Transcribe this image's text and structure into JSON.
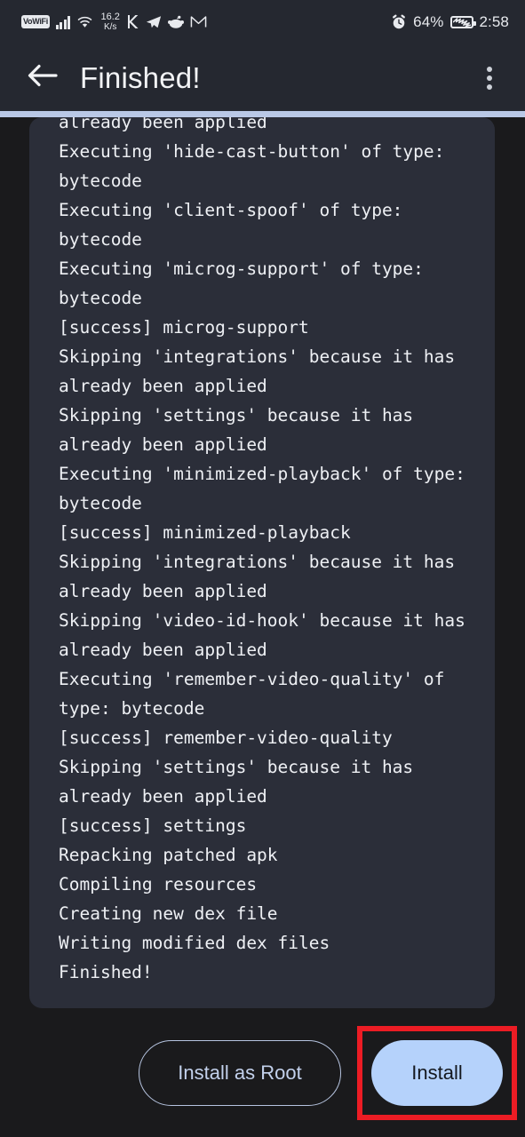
{
  "status_bar": {
    "vowifi_label": "VoWiFi",
    "network_speed_value": "16.2",
    "network_speed_unit": "K/s",
    "app_icons": [
      "kotlin-icon",
      "telegram-icon",
      "reddit-icon",
      "gmail-icon"
    ],
    "alarm_icon": "alarm-clock-icon",
    "battery_percent": "64%",
    "battery_icon": "battery-saver-icon",
    "time": "2:58"
  },
  "app_bar": {
    "back_icon": "back-arrow-icon",
    "title": "Finished!",
    "overflow_icon": "overflow-menu-icon"
  },
  "progress": {
    "percent": 100
  },
  "log": {
    "lines": [
      "already been applied",
      "Executing 'hide-cast-button' of type: bytecode",
      "Executing 'client-spoof' of type: bytecode",
      "Executing 'microg-support' of type: bytecode",
      "[success] microg-support",
      "Skipping 'integrations' because it has already been applied",
      "Skipping 'settings' because it has already been applied",
      "Executing 'minimized-playback' of type: bytecode",
      "[success] minimized-playback",
      "Skipping 'integrations' because it has already been applied",
      "Skipping 'video-id-hook' because it has already been applied",
      "Executing 'remember-video-quality' of type: bytecode",
      "[success] remember-video-quality",
      "Skipping 'settings' because it has already been applied",
      "[success] settings",
      "Repacking patched apk",
      "Compiling resources",
      "Creating new dex file",
      "Writing modified dex files",
      "Finished!"
    ],
    "text": "already been applied\nExecuting 'hide-cast-button' of type: bytecode\nExecuting 'client-spoof' of type: bytecode\nExecuting 'microg-support' of type: bytecode\n[success] microg-support\nSkipping 'integrations' because it has already been applied\nSkipping 'settings' because it has already been applied\nExecuting 'minimized-playback' of type: bytecode\n[success] minimized-playback\nSkipping 'integrations' because it has already been applied\nSkipping 'video-id-hook' because it has already been applied\nExecuting 'remember-video-quality' of type: bytecode\n[success] remember-video-quality\nSkipping 'settings' because it has already been applied\n[success] settings\nRepacking patched apk\nCompiling resources\nCreating new dex file\nWriting modified dex files\nFinished!"
  },
  "actions": {
    "install_as_root_label": "Install as Root",
    "install_label": "Install"
  },
  "annotation": {
    "highlight_color": "#ec1c24",
    "target": "install-button"
  },
  "colors": {
    "page_background": "#1a1a1c",
    "bar_background": "#252830",
    "card_background": "#2b2e39",
    "progress": "#b9c8e6",
    "accent_button": "#b5d2fb",
    "outlined_button_border": "#b6c4e0",
    "log_text": "#eef0f4"
  }
}
